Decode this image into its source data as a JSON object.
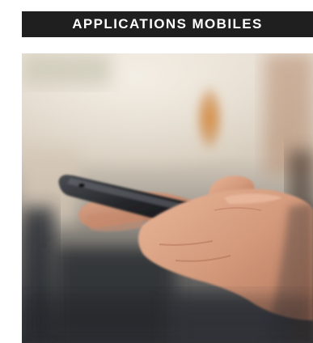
{
  "banner": {
    "label": "APPLICATIONS MOBILES",
    "background": "#1f1f1f",
    "text_color": "#ffffff"
  },
  "hero": {
    "icon": "phone-in-hands-photo"
  }
}
